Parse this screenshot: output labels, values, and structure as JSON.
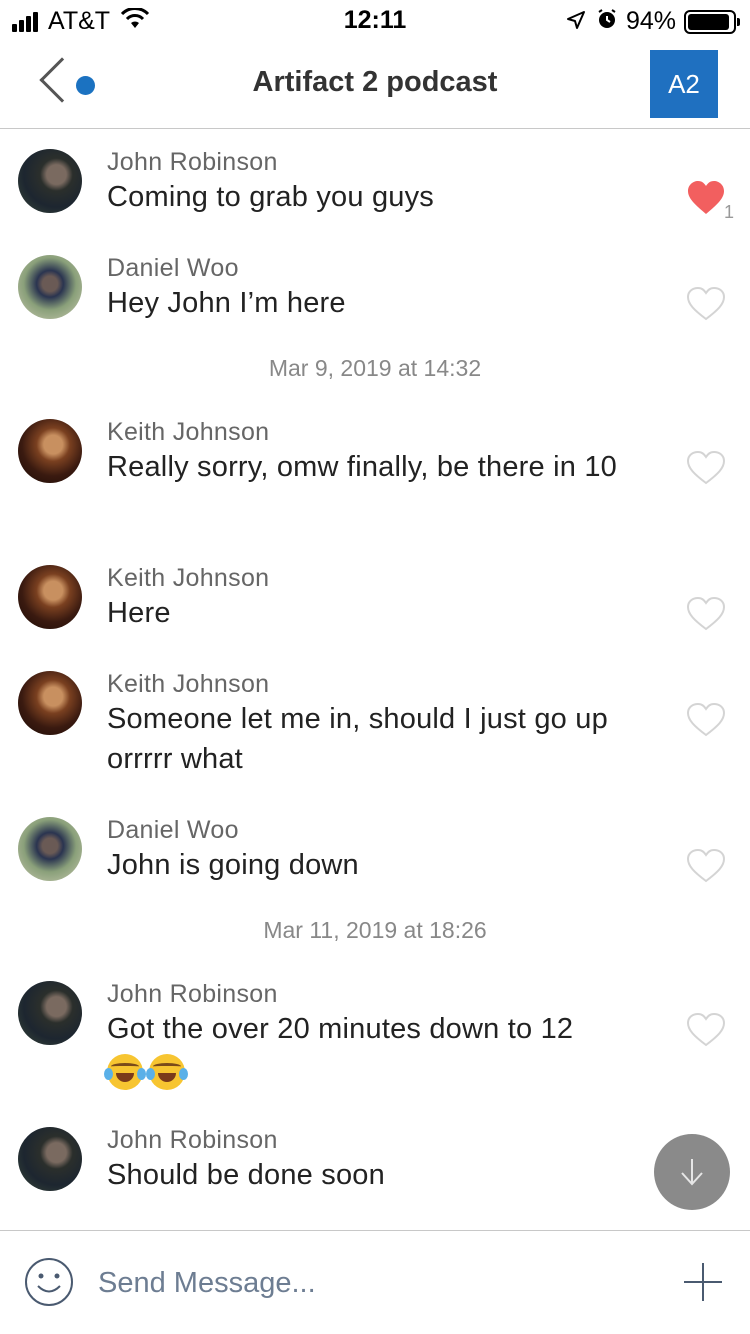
{
  "status_bar": {
    "carrier": "AT&T",
    "time": "12:11",
    "battery_percent": "94%",
    "battery_level": 0.94
  },
  "header": {
    "title": "Artifact 2 podcast",
    "group_initials": "A2",
    "accent_color": "#1f70c0"
  },
  "dividers": [
    "Mar 9, 2019 at 14:32",
    "Mar 11, 2019 at 18:26"
  ],
  "messages": [
    {
      "sender": "John Robinson",
      "text": "Coming to grab you guys",
      "liked": true,
      "like_count": "1"
    },
    {
      "sender": "Daniel Woo",
      "text": "Hey John I’m here",
      "liked": false
    },
    {
      "sender": "Keith Johnson",
      "text": "Really sorry, omw finally, be there in 10",
      "liked": false
    },
    {
      "sender": "Keith Johnson",
      "text": "Here",
      "liked": false
    },
    {
      "sender": "Keith Johnson",
      "text": "Someone let me in, should I just go up orrrrr what",
      "liked": false
    },
    {
      "sender": "Daniel Woo",
      "text": "John is going down",
      "liked": false
    },
    {
      "sender": "John Robinson",
      "text": "Got the over 20 minutes down to 12",
      "emoji": "😂😂",
      "liked": false
    },
    {
      "sender": "John Robinson",
      "text": "Should be done soon",
      "liked": false
    }
  ],
  "composer": {
    "placeholder": "Send Message..."
  },
  "colors": {
    "like_active": "#f25f5f",
    "like_inactive": "#d4d4d4"
  }
}
